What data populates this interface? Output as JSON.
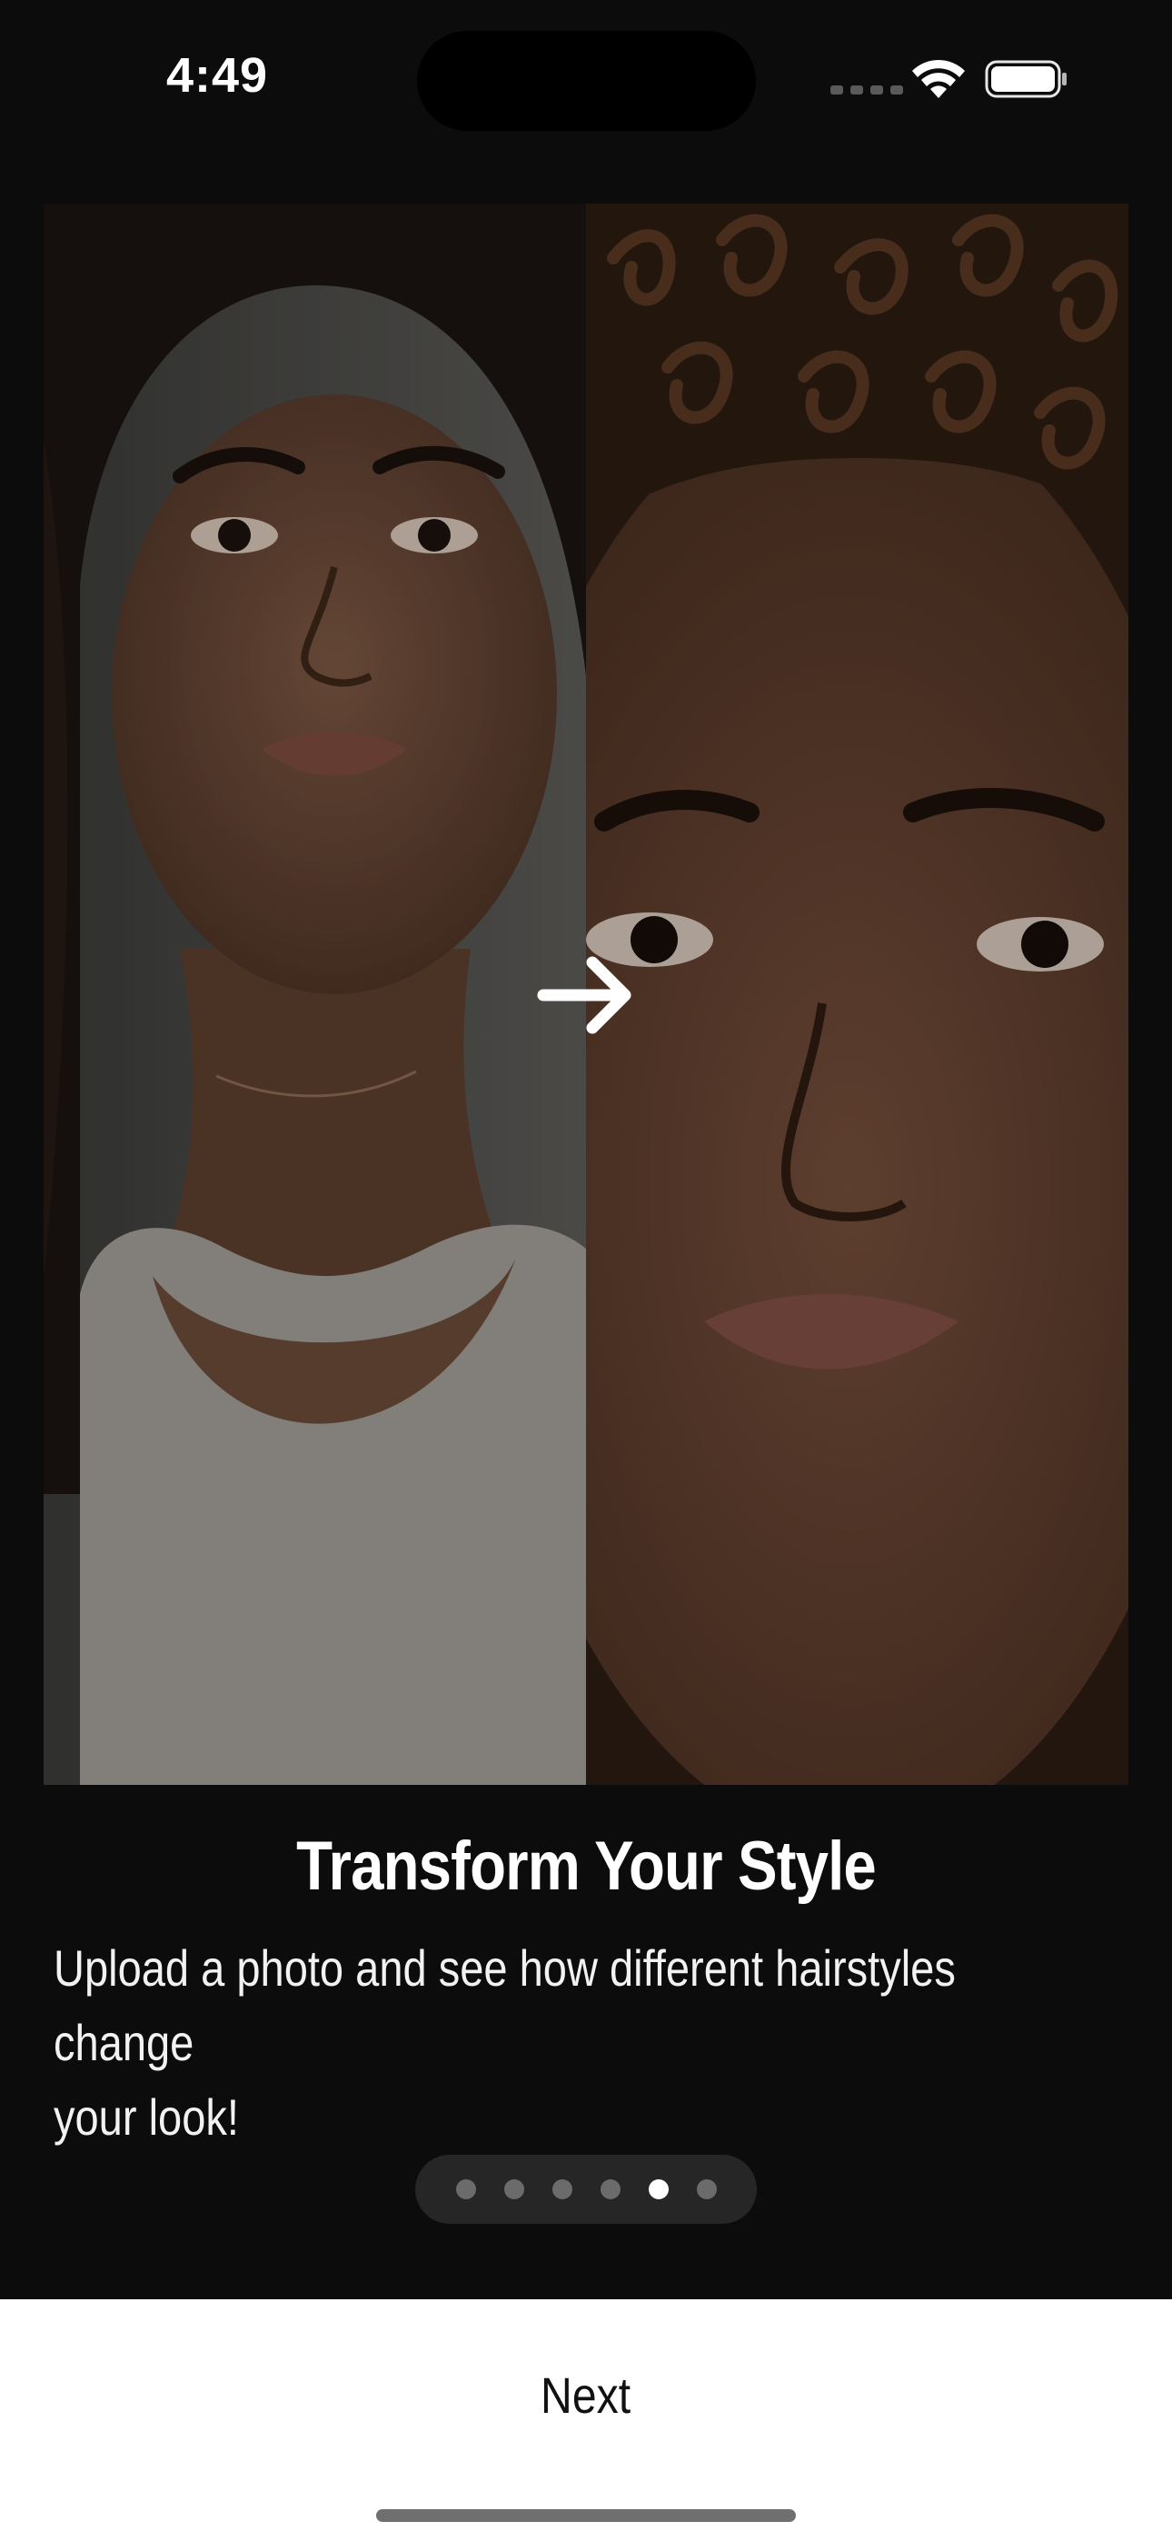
{
  "status_bar": {
    "time": "4:49",
    "wifi_icon": "wifi-icon",
    "battery_icon": "battery-icon"
  },
  "hero": {
    "before_image": "portrait-long-dark-hair",
    "after_image": "portrait-short-curly-hair",
    "arrow_icon": "arrow-right-icon"
  },
  "onboarding": {
    "title": "Transform Your Style",
    "subtitle_line1": "Upload a photo and see how different hairstyles change",
    "subtitle_line2": "your look!",
    "page_count": 6,
    "current_page": 5
  },
  "footer": {
    "next_label": "Next"
  },
  "colors": {
    "background": "#0c0c0c",
    "indicator_track": "#262626",
    "dot_inactive": "#6b6b6b",
    "dot_active": "#ffffff",
    "footer_bg": "#ffffff"
  }
}
